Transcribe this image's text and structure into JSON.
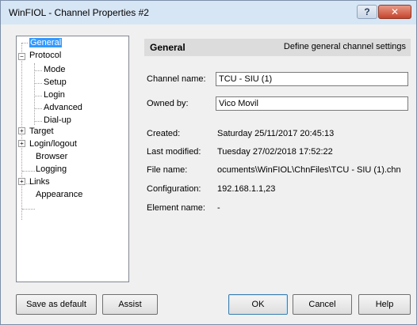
{
  "window": {
    "title": "WinFIOL - Channel Properties #2",
    "help_label": "?",
    "close_label": "✕"
  },
  "tree": {
    "items": [
      {
        "label": "General",
        "selected": true
      },
      {
        "label": "Protocol",
        "expanded": true
      },
      {
        "label": "Mode"
      },
      {
        "label": "Setup"
      },
      {
        "label": "Login"
      },
      {
        "label": "Advanced"
      },
      {
        "label": "Dial-up"
      },
      {
        "label": "Target",
        "expandable": true
      },
      {
        "label": "Login/logout",
        "expandable": true
      },
      {
        "label": "Browser"
      },
      {
        "label": "Logging"
      },
      {
        "label": "Links",
        "expandable": true
      },
      {
        "label": "Appearance"
      }
    ]
  },
  "panel": {
    "title": "General",
    "description": "Define general channel settings",
    "channel_name_label": "Channel name:",
    "channel_name_value": "TCU - SIU (1)",
    "owned_by_label": "Owned by:",
    "owned_by_value": "Vico Movil",
    "created_label": "Created:",
    "created_value": "Saturday  25/11/2017  20:45:13",
    "modified_label": "Last modified:",
    "modified_value": "Tuesday  27/02/2018  17:52:22",
    "filename_label": "File name:",
    "filename_value": "ocuments\\WinFIOL\\ChnFiles\\TCU - SIU (1).chn",
    "config_label": "Configuration:",
    "config_value": "192.168.1.1,23",
    "element_label": "Element name:",
    "element_value": "-"
  },
  "buttons": {
    "save_default": "Save as default",
    "assist": "Assist",
    "ok": "OK",
    "cancel": "Cancel",
    "help": "Help"
  }
}
